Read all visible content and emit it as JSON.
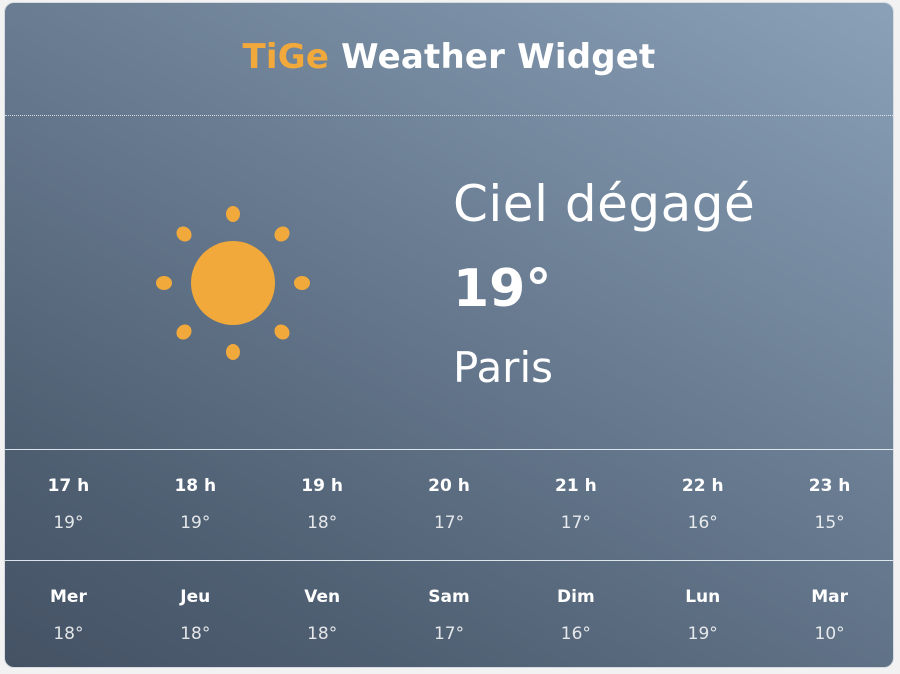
{
  "header": {
    "brand": "TiGe",
    "title": "Weather Widget"
  },
  "current": {
    "icon": "sun-icon",
    "condition": "Ciel dégagé",
    "temperature": "19°",
    "city": "Paris"
  },
  "hourly": [
    {
      "label": "17 h",
      "temp": "19°"
    },
    {
      "label": "18 h",
      "temp": "19°"
    },
    {
      "label": "19 h",
      "temp": "18°"
    },
    {
      "label": "20 h",
      "temp": "17°"
    },
    {
      "label": "21 h",
      "temp": "17°"
    },
    {
      "label": "22 h",
      "temp": "16°"
    },
    {
      "label": "23 h",
      "temp": "15°"
    }
  ],
  "daily": [
    {
      "label": "Mer",
      "temp": "18°"
    },
    {
      "label": "Jeu",
      "temp": "18°"
    },
    {
      "label": "Ven",
      "temp": "18°"
    },
    {
      "label": "Sam",
      "temp": "17°"
    },
    {
      "label": "Dim",
      "temp": "16°"
    },
    {
      "label": "Lun",
      "temp": "19°"
    },
    {
      "label": "Mar",
      "temp": "10°"
    }
  ],
  "colors": {
    "brand": "#f2a93b",
    "sun": "#f2a93b",
    "text": "#ffffff"
  }
}
